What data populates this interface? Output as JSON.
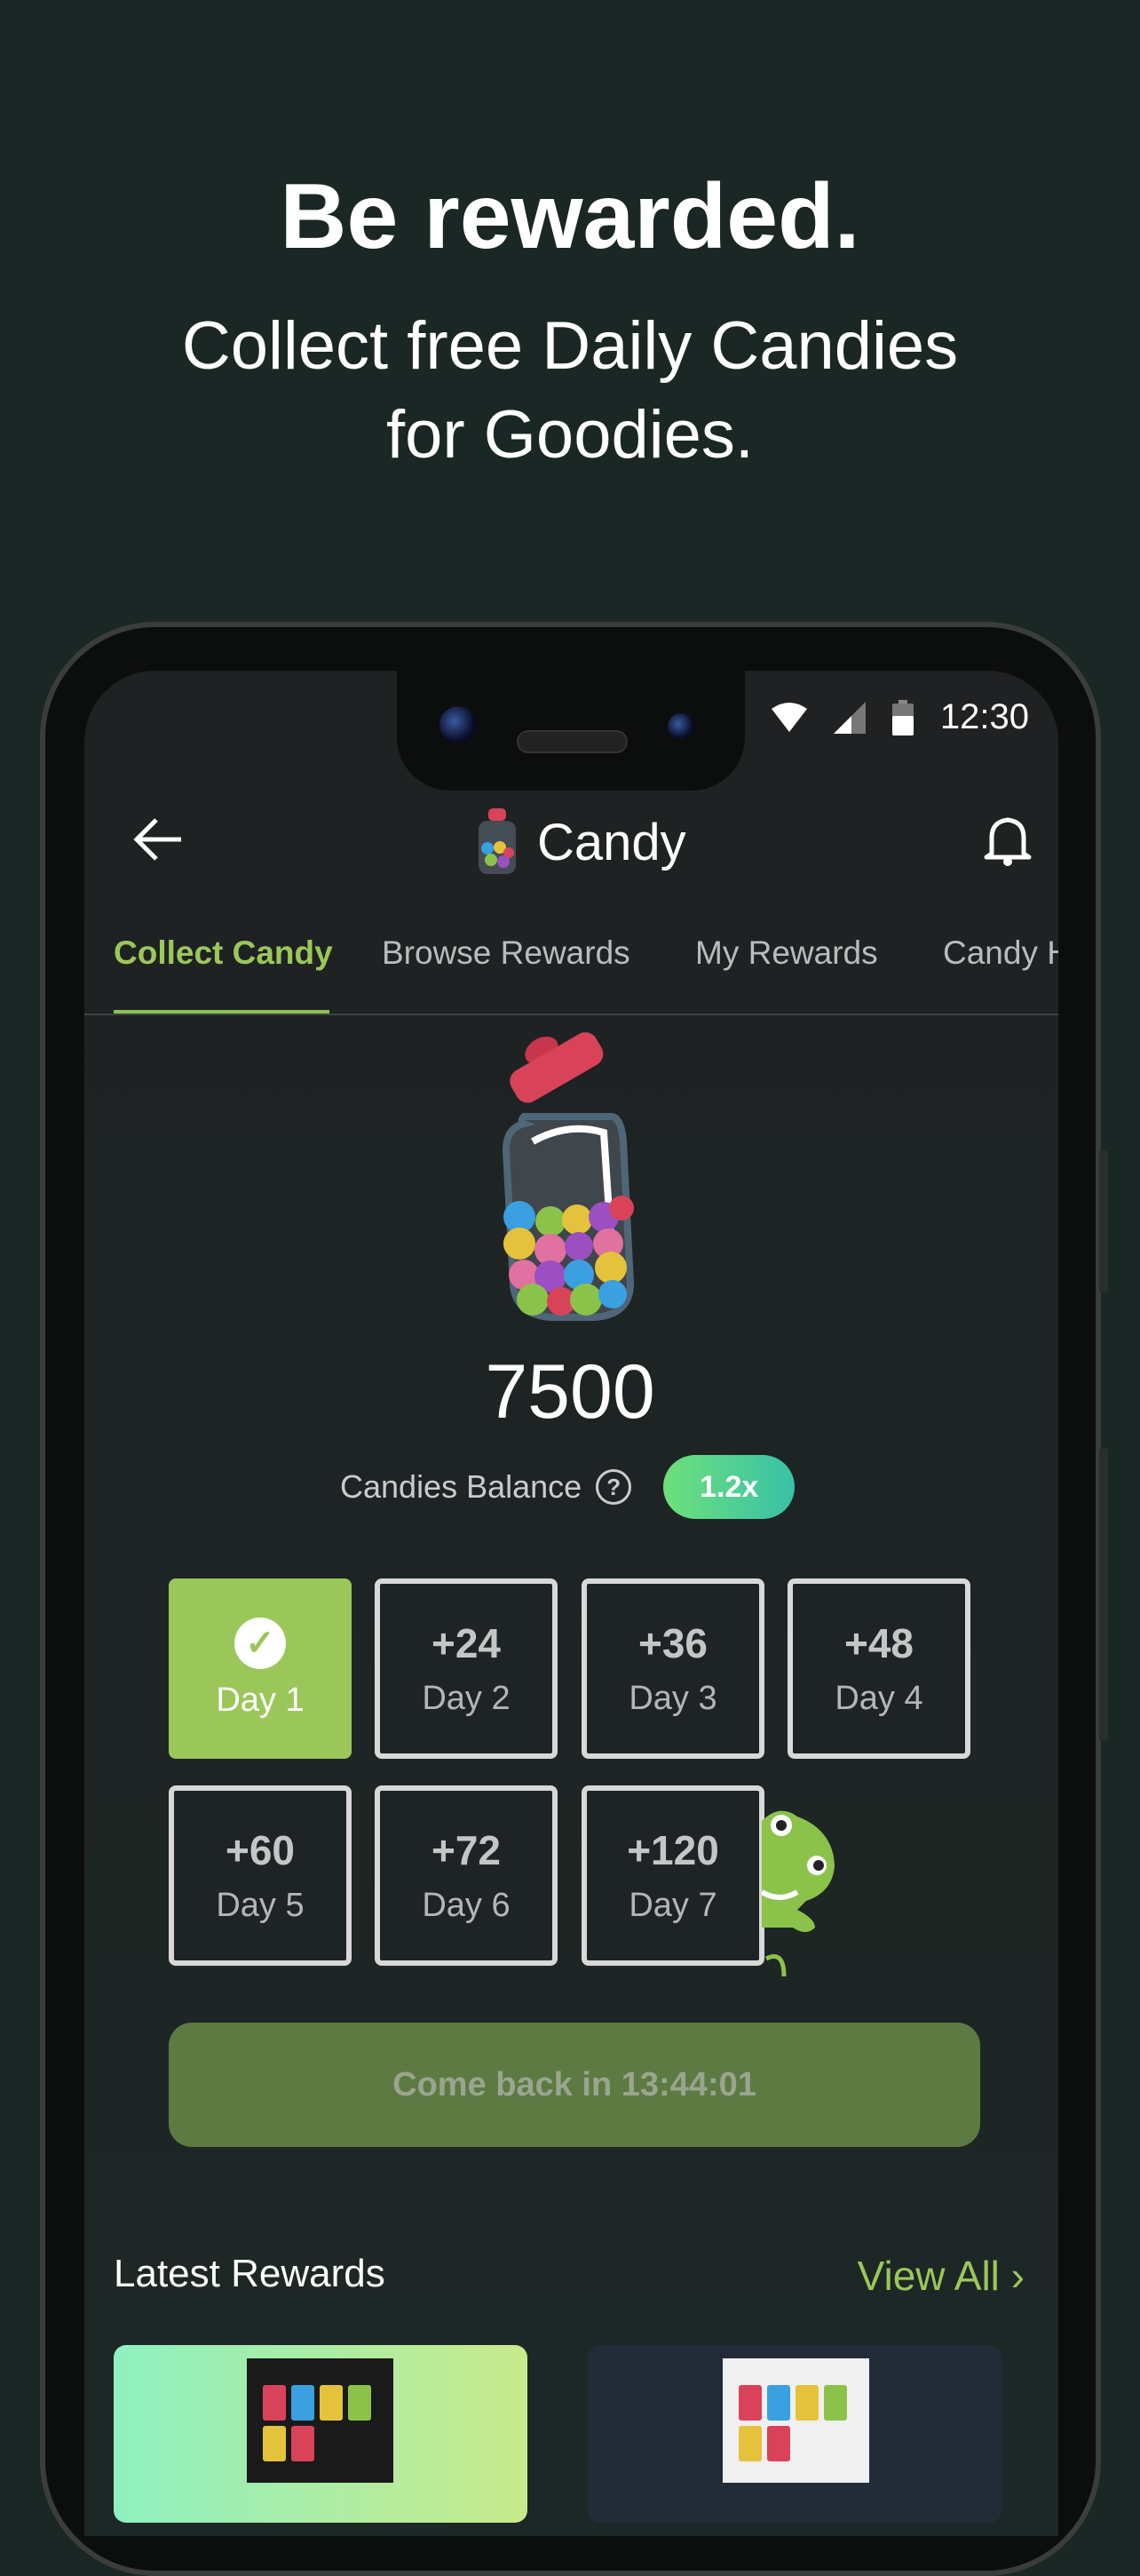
{
  "promo": {
    "headline": "Be rewarded.",
    "subtitle_line1": "Collect free Daily Candies",
    "subtitle_line2": "for Goodies."
  },
  "status_bar": {
    "time": "12:30",
    "icons": [
      "wifi-icon",
      "signal-icon",
      "battery-icon"
    ]
  },
  "header": {
    "title": "Candy",
    "back_icon": "arrow-left-icon",
    "notification_icon": "bell-icon"
  },
  "tabs": [
    {
      "label": "Collect Candy",
      "active": true
    },
    {
      "label": "Browse Rewards"
    },
    {
      "label": "My Rewards"
    },
    {
      "label": "Candy H"
    }
  ],
  "balance": {
    "value": "7500",
    "label": "Candies Balance",
    "multiplier": "1.2x"
  },
  "days": [
    {
      "label": "Day 1",
      "amount": "",
      "collected": true
    },
    {
      "label": "Day 2",
      "amount": "+24"
    },
    {
      "label": "Day 3",
      "amount": "+36"
    },
    {
      "label": "Day 4",
      "amount": "+48"
    },
    {
      "label": "Day 5",
      "amount": "+60"
    },
    {
      "label": "Day 6",
      "amount": "+72"
    },
    {
      "label": "Day 7",
      "amount": "+120"
    }
  ],
  "come_back": "Come back in 13:44:01",
  "latest_rewards": {
    "title": "Latest Rewards",
    "view_all": "View All ›"
  },
  "colors": {
    "accent": "#9bc75a",
    "background": "#1b2724"
  }
}
